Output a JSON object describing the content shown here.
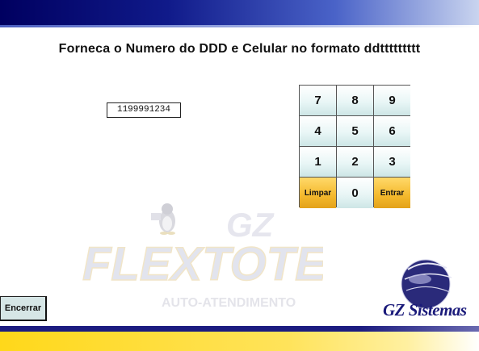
{
  "prompt": "Forneca o Numero do DDD e Celular no formato ddttttttttt",
  "display_value": "1199991234",
  "keypad": {
    "keys": [
      "7",
      "8",
      "9",
      "4",
      "5",
      "6",
      "1",
      "2",
      "3"
    ],
    "clear_label": "Limpar",
    "zero_label": "0",
    "enter_label": "Entrar"
  },
  "watermark": {
    "line1": "GZ",
    "line2": "FLEXTOTEM",
    "line3": "AUTO-ATENDIMENTO"
  },
  "exit_label": "Encerrar",
  "brand": "GZ Sistemas",
  "colors": {
    "header_dark": "#000060",
    "key_action": "#f4b92c",
    "bottom_yellow": "#ffd81a",
    "brand_blue": "#1a1a7a"
  }
}
